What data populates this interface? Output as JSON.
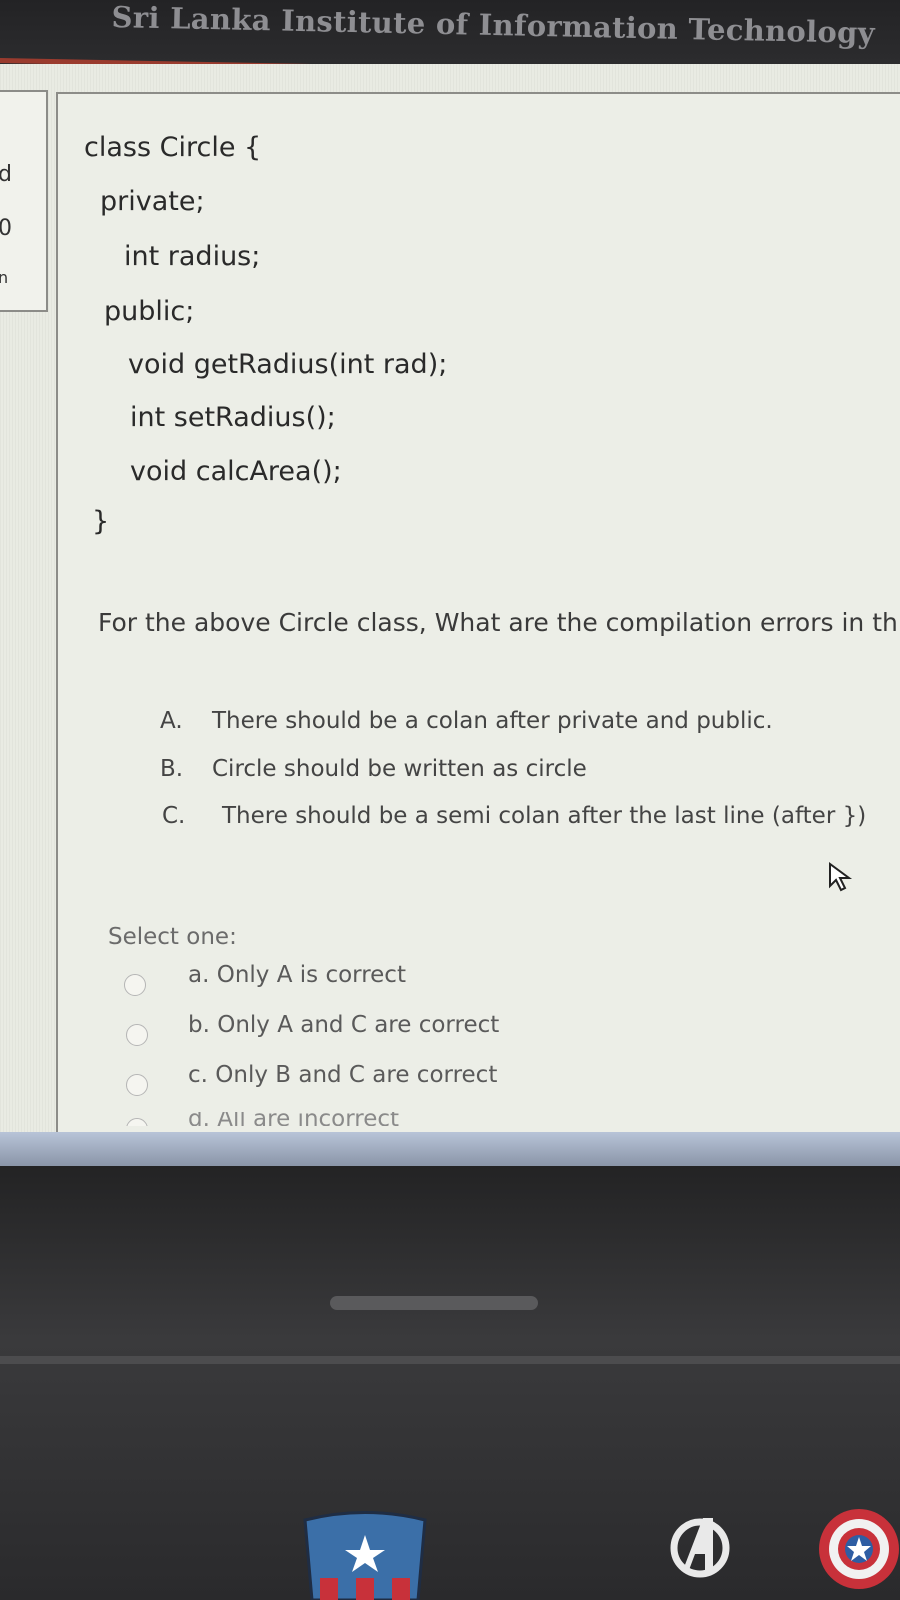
{
  "bezel": {
    "title": "Sri Lanka Institute of Information Technology"
  },
  "left_panel": {
    "fragments": [
      "d",
      "0",
      "n"
    ]
  },
  "code_lines": [
    "class Circle {",
    "private;",
    "int radius;",
    "public;",
    "void getRadius(int rad);",
    "int setRadius();",
    "void calcArea();",
    "}"
  ],
  "question": "For the above Circle class, What are the compilation errors in th",
  "statements": [
    {
      "letter": "A.",
      "text": "There should be a colan after private and public."
    },
    {
      "letter": "B.",
      "text": "Circle should be written as circle"
    },
    {
      "letter": "C.",
      "text": "There should be a semi colan after the last line (after })"
    }
  ],
  "select_label": "Select one:",
  "options": [
    {
      "label": "a. Only A is correct"
    },
    {
      "label": "b. Only A and C are correct"
    },
    {
      "label": "c. Only B and C are correct"
    },
    {
      "label": "d. All are incorrect"
    }
  ],
  "icons": {
    "cursor": "mouse-pointer-icon",
    "sticker1": "captain-america-sticker",
    "sticker2": "avengers-logo-sticker",
    "sticker3": "shield-sticker"
  },
  "colors": {
    "screen_bg": "#e9ebe3",
    "bezel": "#2b2b2d",
    "accent_line": "#9a3b2e"
  }
}
